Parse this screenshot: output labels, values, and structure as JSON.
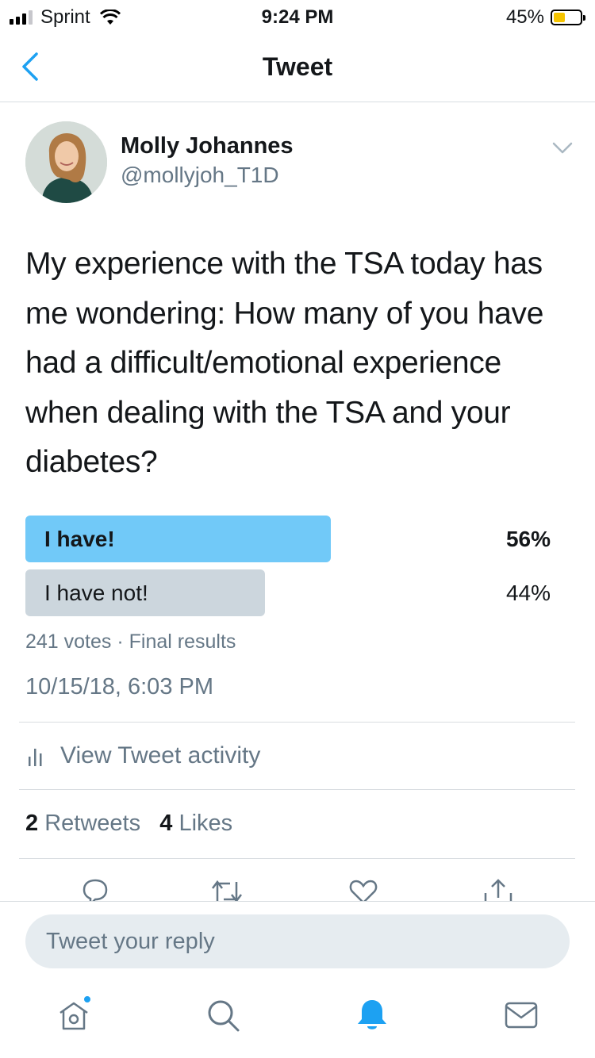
{
  "status_bar": {
    "carrier": "Sprint",
    "time": "9:24 PM",
    "battery_percent": "45%",
    "battery_level": 0.45,
    "battery_color": "#f5c400"
  },
  "nav": {
    "title": "Tweet",
    "back_icon": "chevron-left-icon"
  },
  "author": {
    "name": "Molly Johannes",
    "handle": "@mollyjoh_T1D"
  },
  "tweet": {
    "text": "My experience with the TSA today has me wondering: How many of you have had a difficult/emotional experience when dealing with the TSA and your diabetes?",
    "timestamp": "10/15/18, 6:03 PM"
  },
  "poll": {
    "options": [
      {
        "label": "I have!",
        "percent": "56%",
        "value": 56,
        "winner": true
      },
      {
        "label": "I have not!",
        "percent": "44%",
        "value": 44,
        "winner": false
      }
    ],
    "meta": "241 votes · Final results",
    "winner_color": "#71c9f8",
    "other_color": "#ccd6dd"
  },
  "activity": {
    "label": "View Tweet activity"
  },
  "engagement": {
    "retweets_count": "2",
    "retweets_label": "Retweets",
    "likes_count": "4",
    "likes_label": "Likes"
  },
  "actions": [
    "reply-icon",
    "retweet-icon",
    "like-icon",
    "share-icon"
  ],
  "reply": {
    "placeholder": "Tweet your reply"
  },
  "tab_bar": {
    "items": [
      "home-icon",
      "search-icon",
      "notifications-icon",
      "messages-icon"
    ],
    "active": "notifications-icon",
    "accent": "#1da1f2"
  }
}
